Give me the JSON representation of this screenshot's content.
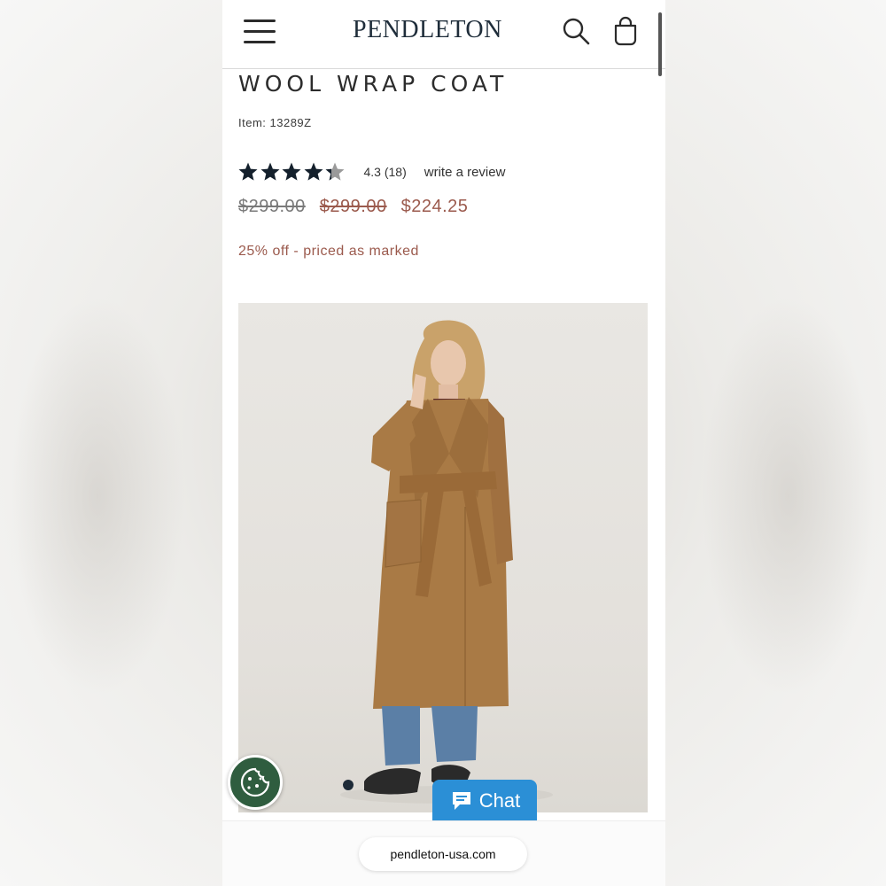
{
  "header": {
    "logo": "PENDLETON",
    "menu_icon": "hamburger-menu-icon",
    "search_icon": "search-icon",
    "bag_icon": "shopping-bag-icon"
  },
  "product": {
    "title": "WOOL WRAP COAT",
    "item_number": "Item: 13289Z",
    "rating": {
      "stars_value": 4.3,
      "stars_max": 5,
      "summary": "4.3 (18)",
      "review_link": "write a review"
    },
    "prices": {
      "original": "$299.00",
      "list": "$299.00",
      "sale": "$224.25"
    },
    "promo": "25% off - priced as marked",
    "carousel": {
      "current": 1
    }
  },
  "widgets": {
    "chat_label": "Chat",
    "cookie_icon": "cookie-icon"
  },
  "browser": {
    "url": "pendleton-usa.com"
  },
  "colors": {
    "brand_navy": "#1f2d3a",
    "sale_red": "#9b5a4d",
    "chat_blue": "#2b8fd6",
    "cookie_green": "#2f5d3f"
  }
}
